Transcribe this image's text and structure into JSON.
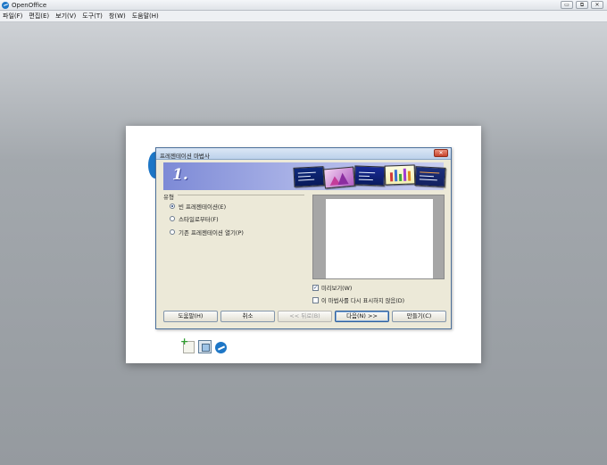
{
  "app": {
    "title": "OpenOffice",
    "window_controls": [
      "▭",
      "⧉",
      "✕"
    ]
  },
  "menubar": {
    "items": [
      "파일(F)",
      "편집(E)",
      "보기(V)",
      "도구(T)",
      "창(W)",
      "도움말(H)"
    ]
  },
  "dialog": {
    "title": "프레젠테이션 마법사",
    "close_label": "✕",
    "step_number": "1.",
    "type_label": "유형",
    "options": [
      {
        "label": "빈 프레젠테이션(E)",
        "checked": true
      },
      {
        "label": "스타일로부터(F)",
        "checked": false
      },
      {
        "label": "기존 프레젠테이션 열기(P)",
        "checked": false
      }
    ],
    "preview_checkbox": {
      "label": "미리보기(W)",
      "checked": true,
      "mark": "✓"
    },
    "dont_show_checkbox": {
      "label": "이 마법사를 다시 표시하지 않음(D)",
      "checked": false,
      "mark": ""
    },
    "buttons": {
      "help": "도움말(H)",
      "cancel": "취소",
      "back": "<< 뒤로(B)",
      "next": "다음(N) >>",
      "create": "만들기(C)"
    }
  },
  "start_center": {
    "icons": [
      "new-document-icon",
      "templates-icon",
      "extensions-icon"
    ]
  },
  "colors": {
    "banner_start": "#7d8ad6",
    "banner_end": "#c8cdf0",
    "dialog_bg": "#ece9d8",
    "accent": "#1d76c6"
  }
}
